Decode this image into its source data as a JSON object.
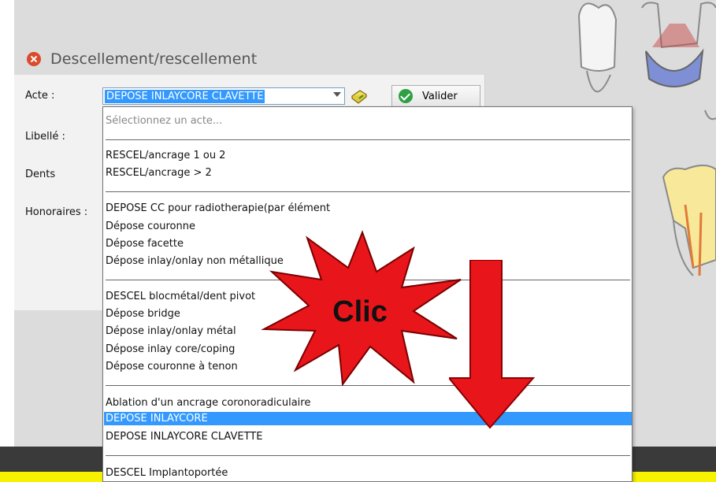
{
  "dialog": {
    "title": "Descellement/rescellement",
    "acte_label": "Acte :",
    "libelle_label": "Libellé :",
    "dents_label": "Dents",
    "honoraires_label": "Honoraires :",
    "acte_value": "DEPOSE INLAYCORE CLAVETTE",
    "valider_label": "Valider"
  },
  "dropdown": {
    "placeholder": "Sélectionnez un acte...",
    "groups": [
      [
        "RESCEL/ancrage 1 ou 2",
        "RESCEL/ancrage > 2"
      ],
      [
        "DEPOSE CC pour radiotherapie(par élément",
        "Dépose couronne",
        "Dépose facette",
        "Dépose inlay/onlay non métallique"
      ],
      [
        "DESCEL blocmétal/dent pivot",
        "Dépose bridge",
        "Dépose inlay/onlay métal",
        "Dépose inlay core/coping",
        "Dépose couronne à tenon"
      ],
      [
        "Ablation d'un ancrage coronoradiculaire",
        "DEPOSE INLAYCORE",
        "DEPOSE INLAYCORE CLAVETTE"
      ],
      [
        "DESCEL Implantoportée"
      ]
    ],
    "selected": "DEPOSE INLAYCORE"
  },
  "annotation": {
    "burst_text": "Clic",
    "burst_color": "#e8161b",
    "arrow_color": "#e8161b"
  },
  "icons": [
    "close-icon",
    "caret-down-icon",
    "book-icon",
    "check-icon"
  ]
}
